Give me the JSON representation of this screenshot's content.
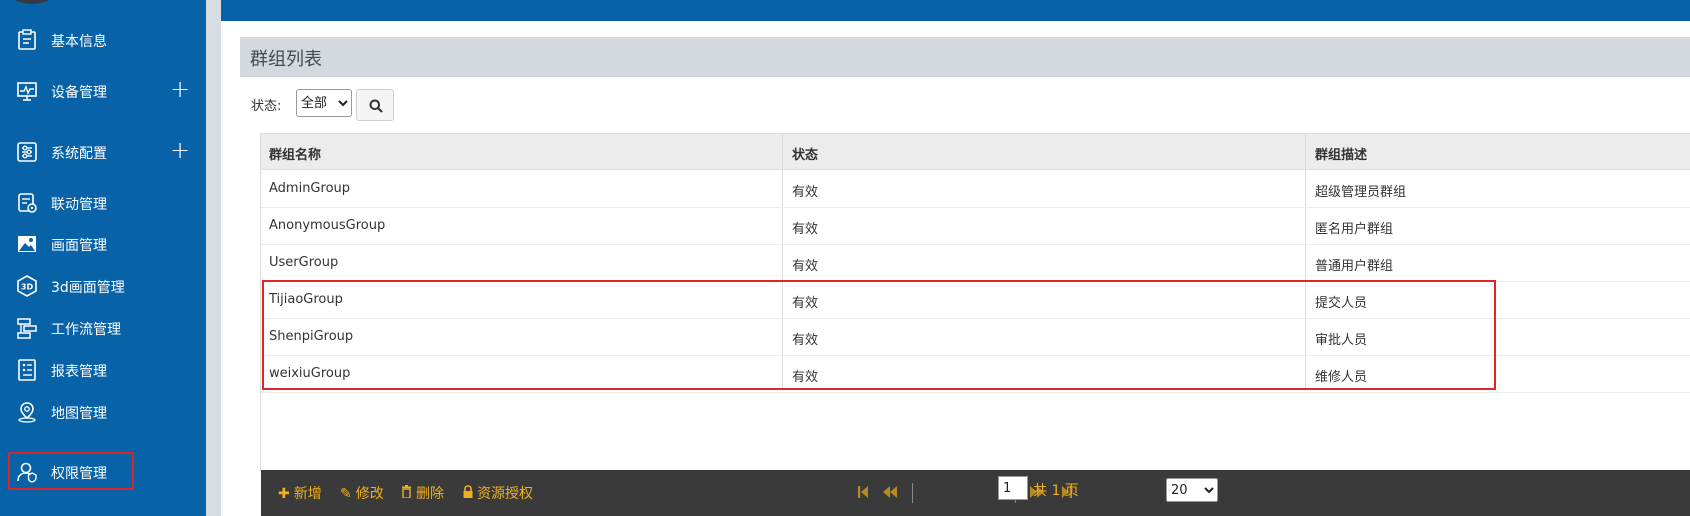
{
  "sidebar": {
    "items": [
      {
        "label": "基本信息",
        "icon": "clipboard-icon",
        "expandable": false
      },
      {
        "label": "设备管理",
        "icon": "monitor-icon",
        "expandable": true
      },
      {
        "label": "系统配置",
        "icon": "settings-sliders-icon",
        "expandable": true
      },
      {
        "label": "联动管理",
        "icon": "linkage-icon",
        "expandable": false
      },
      {
        "label": "画面管理",
        "icon": "image-icon",
        "expandable": false
      },
      {
        "label": "3d画面管理",
        "icon": "3d-icon",
        "expandable": false
      },
      {
        "label": "工作流管理",
        "icon": "workflow-icon",
        "expandable": false
      },
      {
        "label": "报表管理",
        "icon": "report-icon",
        "expandable": false
      },
      {
        "label": "地图管理",
        "icon": "map-pin-icon",
        "expandable": false
      },
      {
        "label": "权限管理",
        "icon": "user-shield-icon",
        "expandable": false,
        "selected": true
      }
    ],
    "expand_symbol": "+"
  },
  "panel": {
    "title": "群组列表"
  },
  "filter": {
    "label": "状态:",
    "status_value": "全部",
    "status_options": [
      "全部"
    ]
  },
  "table": {
    "columns": [
      "群组名称",
      "状态",
      "群组描述"
    ],
    "rows": [
      {
        "name": "AdminGroup",
        "status": "有效",
        "desc": "超级管理员群组"
      },
      {
        "name": "AnonymousGroup",
        "status": "有效",
        "desc": "匿名用户群组"
      },
      {
        "name": "UserGroup",
        "status": "有效",
        "desc": "普通用户群组"
      },
      {
        "name": "TijiaoGroup",
        "status": "有效",
        "desc": "提交人员"
      },
      {
        "name": "ShenpiGroup",
        "status": "有效",
        "desc": "审批人员"
      },
      {
        "name": "weixiuGroup",
        "status": "有效",
        "desc": "维修人员"
      }
    ]
  },
  "toolbar": {
    "add_label": "新增",
    "edit_label": "修改",
    "delete_label": "删除",
    "grant_label": "资源授权"
  },
  "pager": {
    "current_page": "1",
    "total_text": "共 1 页",
    "page_size": "20",
    "page_size_options": [
      "20"
    ]
  },
  "colors": {
    "sidebar_bg": "#0762a8",
    "highlight_red": "#e0242a",
    "toolbar_bg": "#3a3a3a",
    "toolbar_text": "#f0b01d"
  }
}
